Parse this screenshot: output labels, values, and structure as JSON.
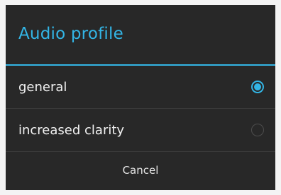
{
  "dialog": {
    "title": "Audio profile",
    "options": [
      {
        "label": "general",
        "selected": true
      },
      {
        "label": "increased clarity",
        "selected": false
      }
    ],
    "cancel_label": "Cancel"
  },
  "colors": {
    "accent": "#33b5e5",
    "dialog_background": "#282828",
    "page_background": "#f4f4f4",
    "text": "#f2f2f2"
  }
}
